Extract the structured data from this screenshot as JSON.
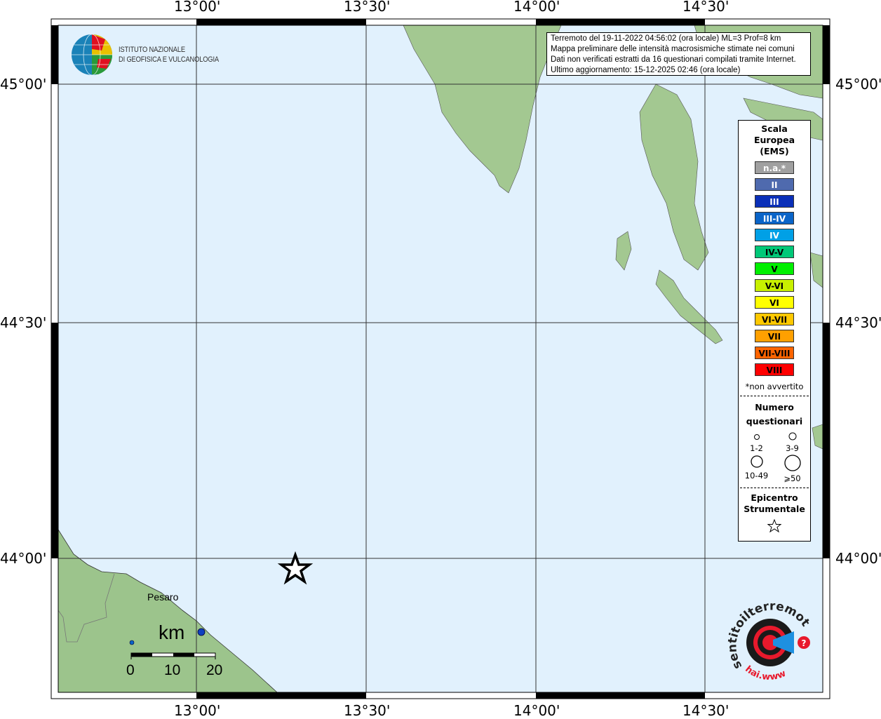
{
  "axes": {
    "lon_labels": [
      "13°00'",
      "13°30'",
      "14°00'",
      "14°30'"
    ],
    "lat_labels": [
      "45°00'",
      "44°30'",
      "44°00'"
    ]
  },
  "logo_ingv": {
    "line1": "ISTITUTO NAZIONALE",
    "line2": "DI GEOFISICA E VULCANOLOGIA"
  },
  "info": {
    "line1": "Terremoto del 19-11-2022 04:56:02 (ora locale) ML=3 Prof=8 km",
    "line2": "Mappa preliminare delle intensità macrosismiche stimate nei comuni",
    "line3": "Dati non verificati estratti da 16 questionari compilati tramite Internet.",
    "line4": "Ultimo aggiornamento: 15-12-2025 02:46 (ora locale)"
  },
  "legend": {
    "title": [
      "Scala",
      "Europea",
      "(EMS)"
    ],
    "classes": [
      {
        "label": "n.a.*",
        "color": "#a0a0a0",
        "text": "#fff"
      },
      {
        "label": "II",
        "color": "#4f6aae",
        "text": "#fff"
      },
      {
        "label": "III",
        "color": "#0a2fb8",
        "text": "#fff"
      },
      {
        "label": "III-IV",
        "color": "#0a64c8",
        "text": "#fff"
      },
      {
        "label": "IV",
        "color": "#00a0e6",
        "text": "#fff"
      },
      {
        "label": "IV-V",
        "color": "#00c878",
        "text": "#000"
      },
      {
        "label": "V",
        "color": "#00f000",
        "text": "#000"
      },
      {
        "label": "V-VI",
        "color": "#c8f000",
        "text": "#000"
      },
      {
        "label": "VI",
        "color": "#ffff00",
        "text": "#000"
      },
      {
        "label": "VI-VII",
        "color": "#ffc800",
        "text": "#000"
      },
      {
        "label": "VII",
        "color": "#ffa000",
        "text": "#000"
      },
      {
        "label": "VII-VIII",
        "color": "#ff6400",
        "text": "#000"
      },
      {
        "label": "VIII",
        "color": "#ff0000",
        "text": "#000"
      }
    ],
    "footnote": "*non avvertito",
    "count_title": [
      "Numero",
      "questionari"
    ],
    "counts": [
      "1-2",
      "3-9",
      "10-49",
      "⩾50"
    ],
    "epicenter_title": [
      "Epicentro",
      "Strumentale"
    ]
  },
  "places": [
    {
      "name": "Pesaro"
    }
  ],
  "scale_bar": {
    "unit": "km",
    "ticks": [
      "0",
      "10",
      "20"
    ]
  },
  "logo_hst": {
    "text": "www.haisentitoilterremoto.it"
  },
  "colors": {
    "sea": "#e1f1fd",
    "land": "#9cc48c",
    "intensity_points": "#1040c0"
  }
}
